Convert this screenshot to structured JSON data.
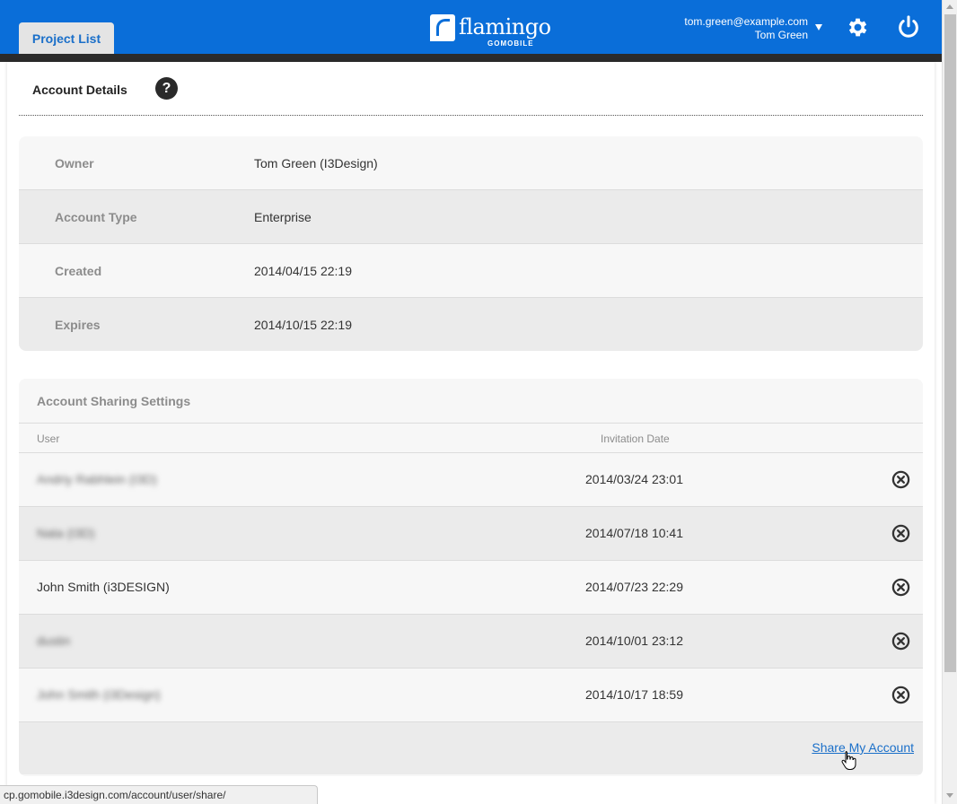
{
  "header": {
    "tab_label": "Project List",
    "logo_text": "flamingo",
    "logo_sub": "GOMOBILE",
    "user_email": "tom.green@example.com",
    "user_name": "Tom Green"
  },
  "page": {
    "title": "Account Details",
    "help_glyph": "?"
  },
  "details": [
    {
      "label": "Owner",
      "value": "Tom Green (I3Design)"
    },
    {
      "label": "Account Type",
      "value": "Enterprise"
    },
    {
      "label": "Created",
      "value": "2014/04/15 22:19"
    },
    {
      "label": "Expires",
      "value": "2014/10/15 22:19"
    }
  ],
  "sharing": {
    "title": "Account Sharing Settings",
    "col_user": "User",
    "col_date": "Invitation Date",
    "rows": [
      {
        "user": "Andriy Rabhlein (I3D)",
        "date": "2014/03/24 23:01",
        "blurred": true
      },
      {
        "user": "Nata (I3D)",
        "date": "2014/07/18 10:41",
        "blurred": true
      },
      {
        "user": "John Smith (i3DESIGN)",
        "date": "2014/07/23 22:29",
        "blurred": false
      },
      {
        "user": "dustin",
        "date": "2014/10/01 23:12",
        "blurred": true
      },
      {
        "user": "John Smith (i3Design)",
        "date": "2014/10/17 18:59",
        "blurred": true
      }
    ],
    "share_link": "Share My Account"
  },
  "statusbar": {
    "url": "cp.gomobile.i3design.com/account/user/share/"
  },
  "colors": {
    "header_blue": "#0a6ed9",
    "link_blue": "#1a6fc9",
    "header_dark_bar": "#2b2b2b"
  },
  "icons": [
    "gear-icon",
    "power-icon",
    "help-icon",
    "remove-icon",
    "chevron-down-icon",
    "hand-cursor-icon"
  ]
}
